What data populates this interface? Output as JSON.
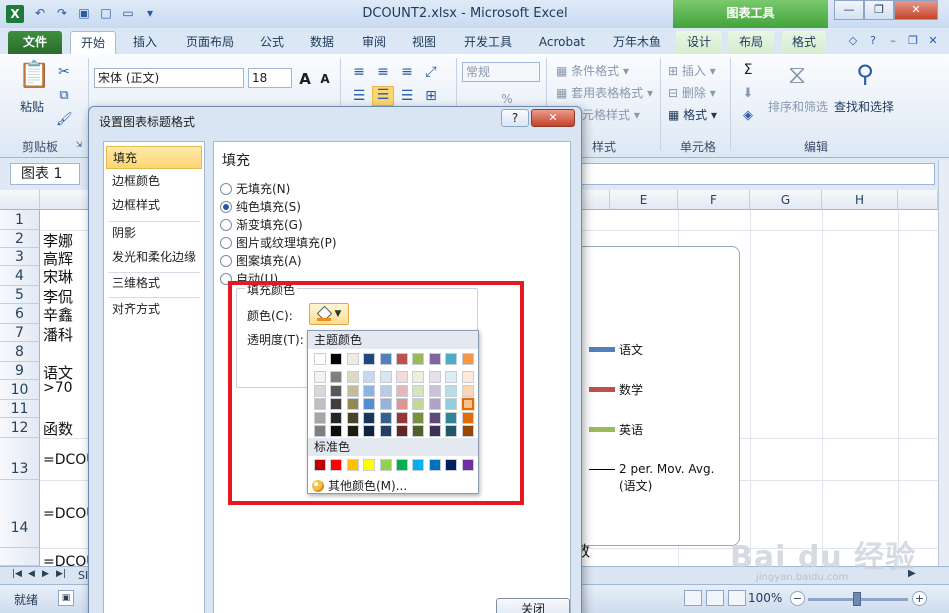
{
  "window": {
    "title": "DCOUNT2.xlsx - Microsoft Excel",
    "contextual_tab_group": "图表工具",
    "app_icon": "X"
  },
  "tabs": [
    "文件",
    "开始",
    "插入",
    "页面布局",
    "公式",
    "数据",
    "审阅",
    "视图",
    "开发工具",
    "Acrobat",
    "万年木鱼",
    "设计",
    "布局",
    "格式"
  ],
  "ribbon": {
    "font_name": "宋体 (正文)",
    "font_size": "18",
    "grow_font": "A",
    "shrink_font": "A",
    "paste_label": "粘贴",
    "clipboard_label": "剪贴板",
    "number_format": "常规",
    "percent": "%",
    "conditional_format": "条件格式",
    "table_format": "套用表格格式",
    "cell_style": "元格样式",
    "style_label": "样式",
    "insert": "插入",
    "delete": "删除",
    "format": "格式",
    "cells_label": "单元格",
    "sigma": "Σ",
    "sort_filter": "排序和筛选",
    "find_select": "查找和选择",
    "edit_label": "编辑"
  },
  "namebox": "图表 1",
  "columns": [
    "E",
    "F",
    "G",
    "H"
  ],
  "rows": [
    {
      "n": "1",
      "text": ""
    },
    {
      "n": "2",
      "text": "李娜"
    },
    {
      "n": "3",
      "text": "高辉"
    },
    {
      "n": "4",
      "text": "宋琳"
    },
    {
      "n": "5",
      "text": "李侃"
    },
    {
      "n": "6",
      "text": "辛鑫"
    },
    {
      "n": "7",
      "text": "潘科"
    },
    {
      "n": "8",
      "text": ""
    },
    {
      "n": "9",
      "text": "语文"
    },
    {
      "n": "10",
      "text": ">70"
    },
    {
      "n": "11",
      "text": ""
    },
    {
      "n": "12",
      "text": "函数"
    },
    {
      "n": "13",
      "text": "=DCOUN"
    },
    {
      "n": "14",
      "text": "=DCOUN"
    },
    {
      "n": "",
      "text": "=DCOUN"
    }
  ],
  "chart_legend": [
    {
      "label": "语文",
      "color": "#4f81bd"
    },
    {
      "label": "数学",
      "color": "#c0504d"
    },
    {
      "label": "英语",
      "color": "#9bbb59"
    },
    {
      "label": "2 per. Mov. Avg. (语文)",
      "color": "#000000"
    }
  ],
  "cell_annotation": "数",
  "sheet_tab_partial": "SI",
  "status": {
    "ready": "就绪",
    "zoom": "100%",
    "zoom_minus": "−",
    "zoom_plus": "+"
  },
  "dialog": {
    "title": "设置图表标题格式",
    "help": "?",
    "nav": [
      "填充",
      "边框颜色",
      "边框样式",
      "阴影",
      "发光和柔化边缘",
      "三维格式",
      "对齐方式"
    ],
    "section_title": "填充",
    "fill_options": [
      {
        "label": "无填充(N)",
        "selected": false
      },
      {
        "label": "纯色填充(S)",
        "selected": true
      },
      {
        "label": "渐变填充(G)",
        "selected": false
      },
      {
        "label": "图片或纹理填充(P)",
        "selected": false
      },
      {
        "label": "图案填充(A)",
        "selected": false
      },
      {
        "label": "自动(U)",
        "selected": false
      }
    ],
    "fill_color_group": "填充颜色",
    "color_label": "颜色(C):",
    "transparency_label": "透明度(T):",
    "close_button": "关闭"
  },
  "color_popup": {
    "theme_header": "主题颜色",
    "standard_header": "标准色",
    "more_colors": "其他颜色(M)...",
    "theme_top": [
      "#ffffff",
      "#000000",
      "#eeece1",
      "#1f497d",
      "#4f81bd",
      "#c0504d",
      "#9bbb59",
      "#8064a2",
      "#4bacc6",
      "#f79646"
    ],
    "theme_shades": [
      [
        "#f2f2f2",
        "#7f7f7f",
        "#ddd9c3",
        "#c6d9f0",
        "#dbe5f1",
        "#f2dcdb",
        "#ebf1dd",
        "#e5e0ec",
        "#dbeef3",
        "#fdeada"
      ],
      [
        "#d8d8d8",
        "#595959",
        "#c4bd97",
        "#8db3e2",
        "#b8cce4",
        "#e5b9b7",
        "#d7e3bc",
        "#ccc1d9",
        "#b7dde8",
        "#fbd5b5"
      ],
      [
        "#bfbfbf",
        "#3f3f3f",
        "#938953",
        "#548dd4",
        "#95b3d7",
        "#d99694",
        "#c3d69b",
        "#b2a2c7",
        "#92cddc",
        "#fac08f"
      ],
      [
        "#a5a5a5",
        "#262626",
        "#494429",
        "#17365d",
        "#366092",
        "#953734",
        "#76923c",
        "#5f497a",
        "#31859b",
        "#e36c09"
      ],
      [
        "#7f7f7f",
        "#0c0c0c",
        "#1d1b10",
        "#0f243e",
        "#244061",
        "#632423",
        "#4f6128",
        "#3f3151",
        "#205867",
        "#974806"
      ]
    ],
    "standard": [
      "#c00000",
      "#ff0000",
      "#ffc000",
      "#ffff00",
      "#92d050",
      "#00b050",
      "#00b0f0",
      "#0070c0",
      "#002060",
      "#7030a0"
    ]
  },
  "watermark": {
    "main": "Bai du 经验",
    "sub": "jingyan.baidu.com"
  }
}
